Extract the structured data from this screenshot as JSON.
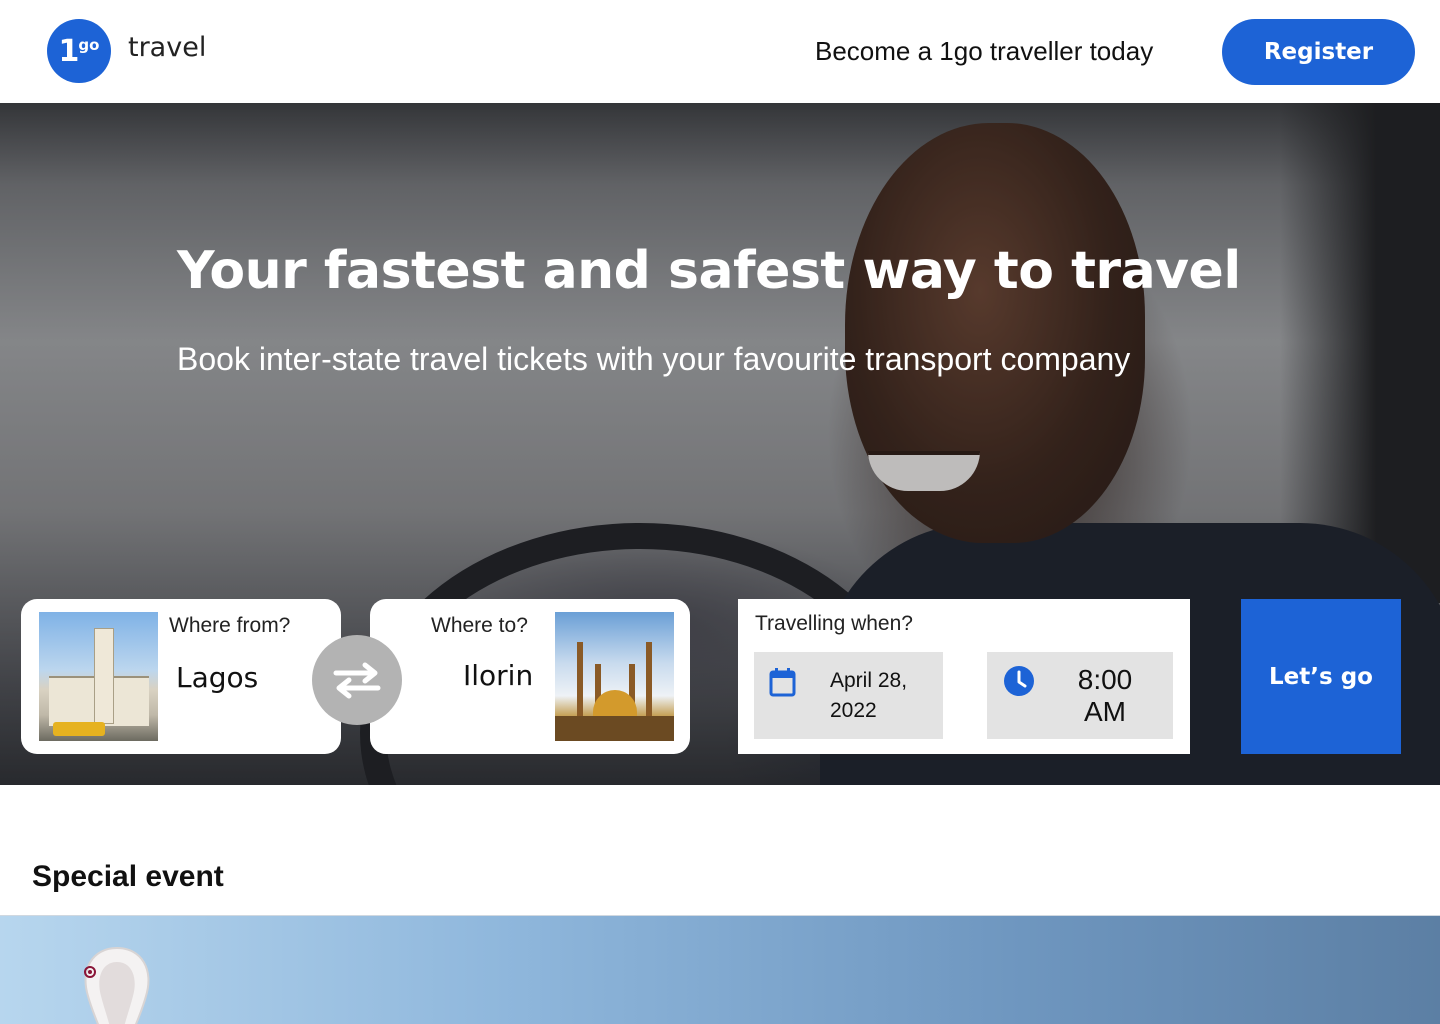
{
  "header": {
    "logo_main": "1",
    "logo_sup": "go",
    "logo_word": "travel",
    "tagline": "Become a 1go traveller today",
    "register_label": "Register"
  },
  "hero": {
    "title": "Your fastest and safest way to travel",
    "subtitle": "Book inter-state travel tickets with your favourite transport company"
  },
  "booking": {
    "from": {
      "label": "Where from?",
      "city": "Lagos"
    },
    "to": {
      "label": "Where to?",
      "city": "Ilorin"
    },
    "when": {
      "label": "Travelling when?",
      "date": "April 28, 2022",
      "time": "8:00 AM"
    },
    "submit_label": "Let’s go"
  },
  "special_event": {
    "title": "Special event"
  },
  "icons": [
    "swap-icon",
    "calendar-icon",
    "clock-icon",
    "trophy-icon"
  ],
  "colors": {
    "brand": "#1d63d6",
    "swap_button": "#b3b3b3",
    "field_bg": "#e3e3e3"
  }
}
